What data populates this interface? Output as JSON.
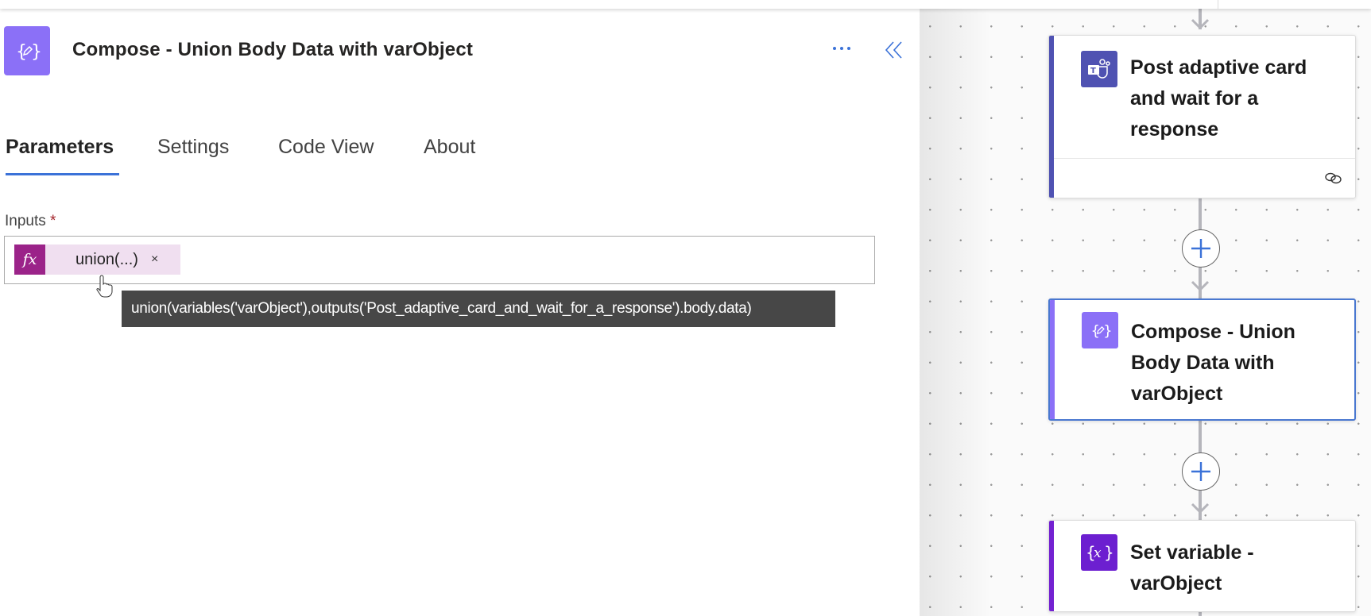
{
  "panel": {
    "title": "Compose - Union Body Data with varObject",
    "tabs": [
      {
        "label": "Parameters",
        "active": true
      },
      {
        "label": "Settings"
      },
      {
        "label": "Code View"
      },
      {
        "label": "About"
      }
    ],
    "inputs_label": "Inputs",
    "required_mark": "*",
    "token": {
      "icon_text": "fx",
      "label": "union(...)",
      "remove": "×"
    },
    "tooltip": "union(variables('varObject'),outputs('Post_adaptive_card_and_wait_for_a_response').body.data)"
  },
  "flow": {
    "cards": [
      {
        "title": "Post adaptive card and wait for a response",
        "lines": [
          "Post adaptive card",
          "and wait for a",
          "response"
        ],
        "accent": "#4f52b2",
        "icon": "teams-icon"
      },
      {
        "title": "Compose - Union Body Data with varObject",
        "lines": [
          "Compose - Union",
          "Body Data with",
          "varObject"
        ],
        "accent": "#8b70f7",
        "icon": "compose-icon",
        "selected": true
      },
      {
        "title": "Set variable - varObject",
        "lines": [
          "Set variable -",
          "varObject"
        ],
        "accent": "#7321d1",
        "icon": "variable-icon"
      }
    ]
  },
  "colors": {
    "brand_blue": "#3b72d8",
    "fx_purple": "#9b2389",
    "tooltip_bg": "#474747"
  }
}
